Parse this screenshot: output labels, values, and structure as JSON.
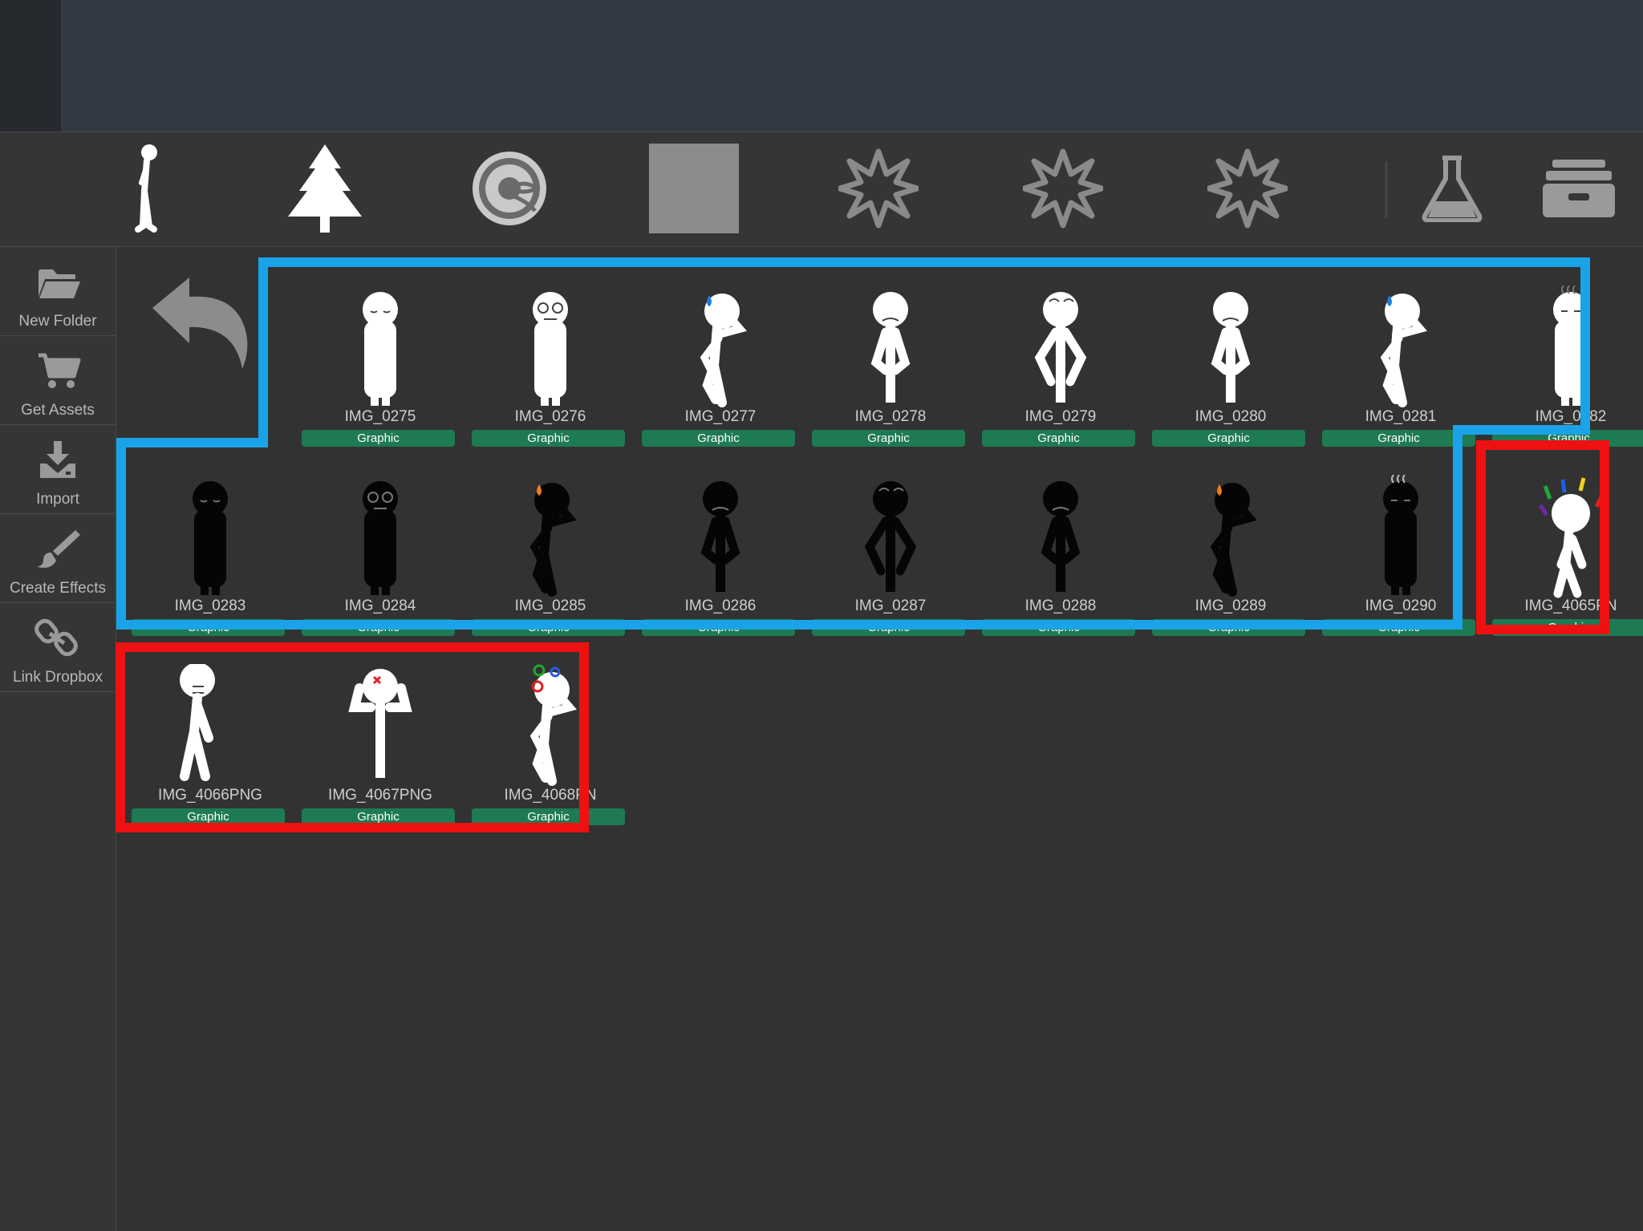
{
  "toolbar": {
    "icons": [
      "stick-figure-icon",
      "tree-icon",
      "gear-icon",
      "gray-square-icon",
      "starburst-icon",
      "starburst-icon",
      "starburst-icon",
      "flask-icon",
      "storage-box-icon"
    ]
  },
  "sidebar": {
    "items": [
      {
        "label": "New Folder",
        "icon": "folder-icon"
      },
      {
        "label": "Get Assets",
        "icon": "cart-icon"
      },
      {
        "label": "Import",
        "icon": "import-icon"
      },
      {
        "label": "Create Effects",
        "icon": "brush-icon"
      },
      {
        "label": "Link Dropbox",
        "icon": "link-icon"
      }
    ]
  },
  "assets": [
    {
      "name": "IMG_0275",
      "tag": "Graphic",
      "figure": "white-stand"
    },
    {
      "name": "IMG_0276",
      "tag": "Graphic",
      "figure": "white-stand-spiral"
    },
    {
      "name": "IMG_0277",
      "tag": "Graphic",
      "figure": "white-think-sweat"
    },
    {
      "name": "IMG_0278",
      "tag": "Graphic",
      "figure": "white-arms-frown"
    },
    {
      "name": "IMG_0279",
      "tag": "Graphic",
      "figure": "white-arms-up"
    },
    {
      "name": "IMG_0280",
      "tag": "Graphic",
      "figure": "white-arms-angry"
    },
    {
      "name": "IMG_0281",
      "tag": "Graphic",
      "figure": "white-think-sweat"
    },
    {
      "name": "IMG_0282",
      "tag": "Graphic",
      "figure": "white-stand-steam"
    },
    {
      "name": "IMG_0283",
      "tag": "Graphic",
      "figure": "black-stand"
    },
    {
      "name": "IMG_0284",
      "tag": "Graphic",
      "figure": "black-stand-spiral"
    },
    {
      "name": "IMG_0285",
      "tag": "Graphic",
      "figure": "black-think-sweat"
    },
    {
      "name": "IMG_0286",
      "tag": "Graphic",
      "figure": "black-arms-frown"
    },
    {
      "name": "IMG_0287",
      "tag": "Graphic",
      "figure": "black-arms-up"
    },
    {
      "name": "IMG_0288",
      "tag": "Graphic",
      "figure": "black-arms-angry"
    },
    {
      "name": "IMG_0289",
      "tag": "Graphic",
      "figure": "black-think-sweat"
    },
    {
      "name": "IMG_0290",
      "tag": "Graphic",
      "figure": "black-stand-steam"
    },
    {
      "name": "IMG_4065PN",
      "tag": "Graphic",
      "figure": "white-exclaim"
    },
    {
      "name": "IMG_4066PNG",
      "tag": "Graphic",
      "figure": "white-lean"
    },
    {
      "name": "IMG_4067PNG",
      "tag": "Graphic",
      "figure": "white-flex"
    },
    {
      "name": "IMG_4068PN",
      "tag": "Graphic",
      "figure": "white-think-dizzy"
    }
  ],
  "colors": {
    "tag_green": "#1e7a53",
    "highlight_blue": "#1aa3e8",
    "highlight_red": "#ee1111"
  }
}
